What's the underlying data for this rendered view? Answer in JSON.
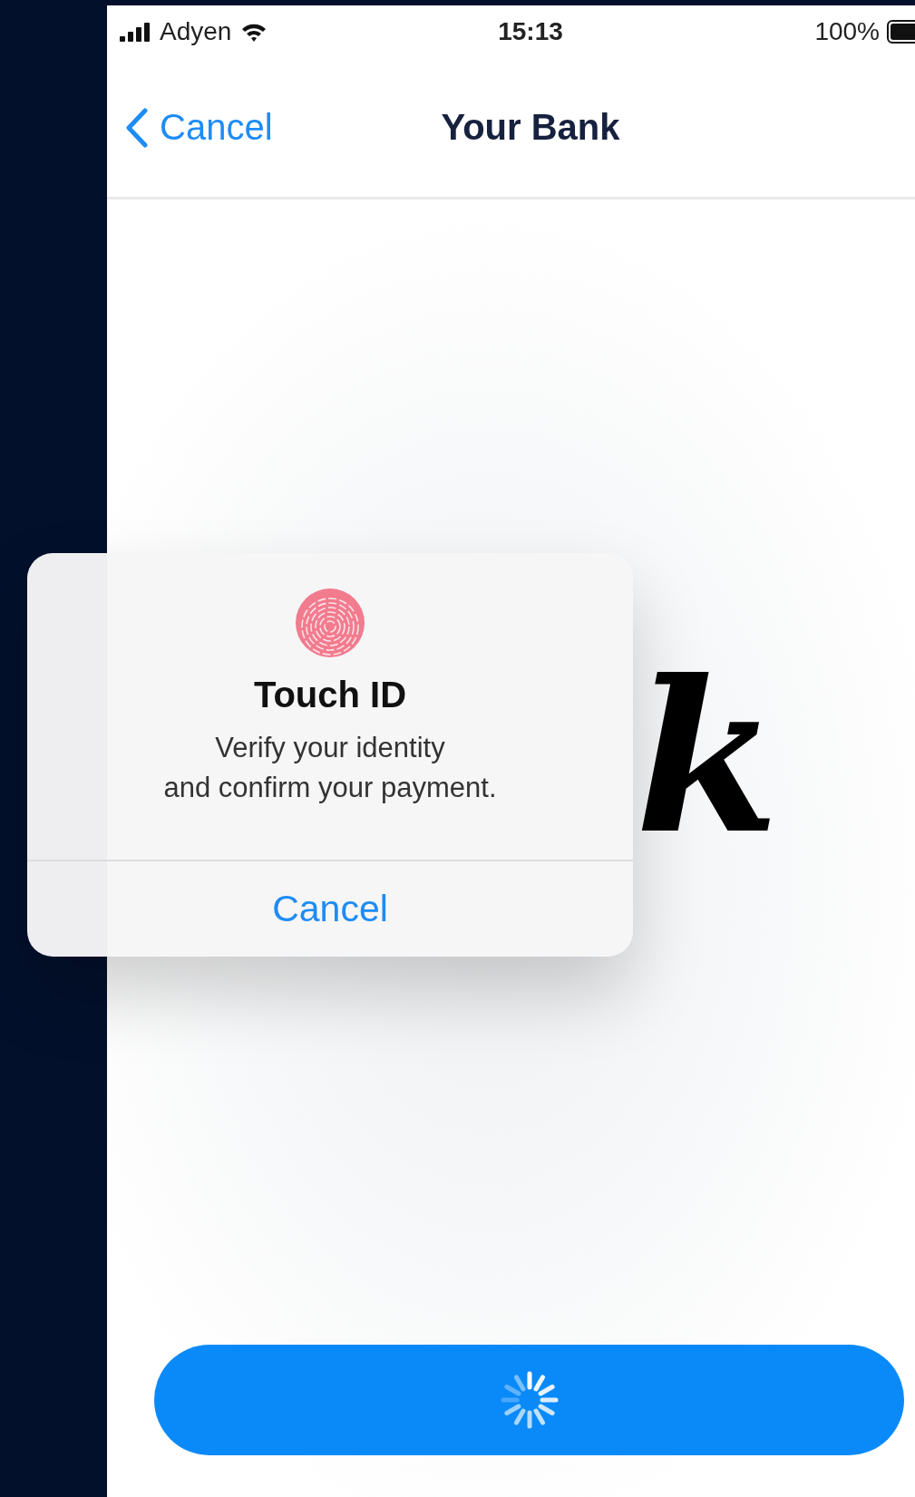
{
  "status_bar": {
    "carrier": "Adyen",
    "time": "15:13",
    "battery": "100%"
  },
  "nav": {
    "back": "Cancel",
    "title": "Your Bank"
  },
  "logo": {
    "text": "k"
  },
  "dialog": {
    "title": "Touch ID",
    "message_lines": [
      "Verify your identity",
      "and confirm your payment."
    ],
    "button": "Cancel"
  },
  "pay_button": {
    "loading": true
  }
}
